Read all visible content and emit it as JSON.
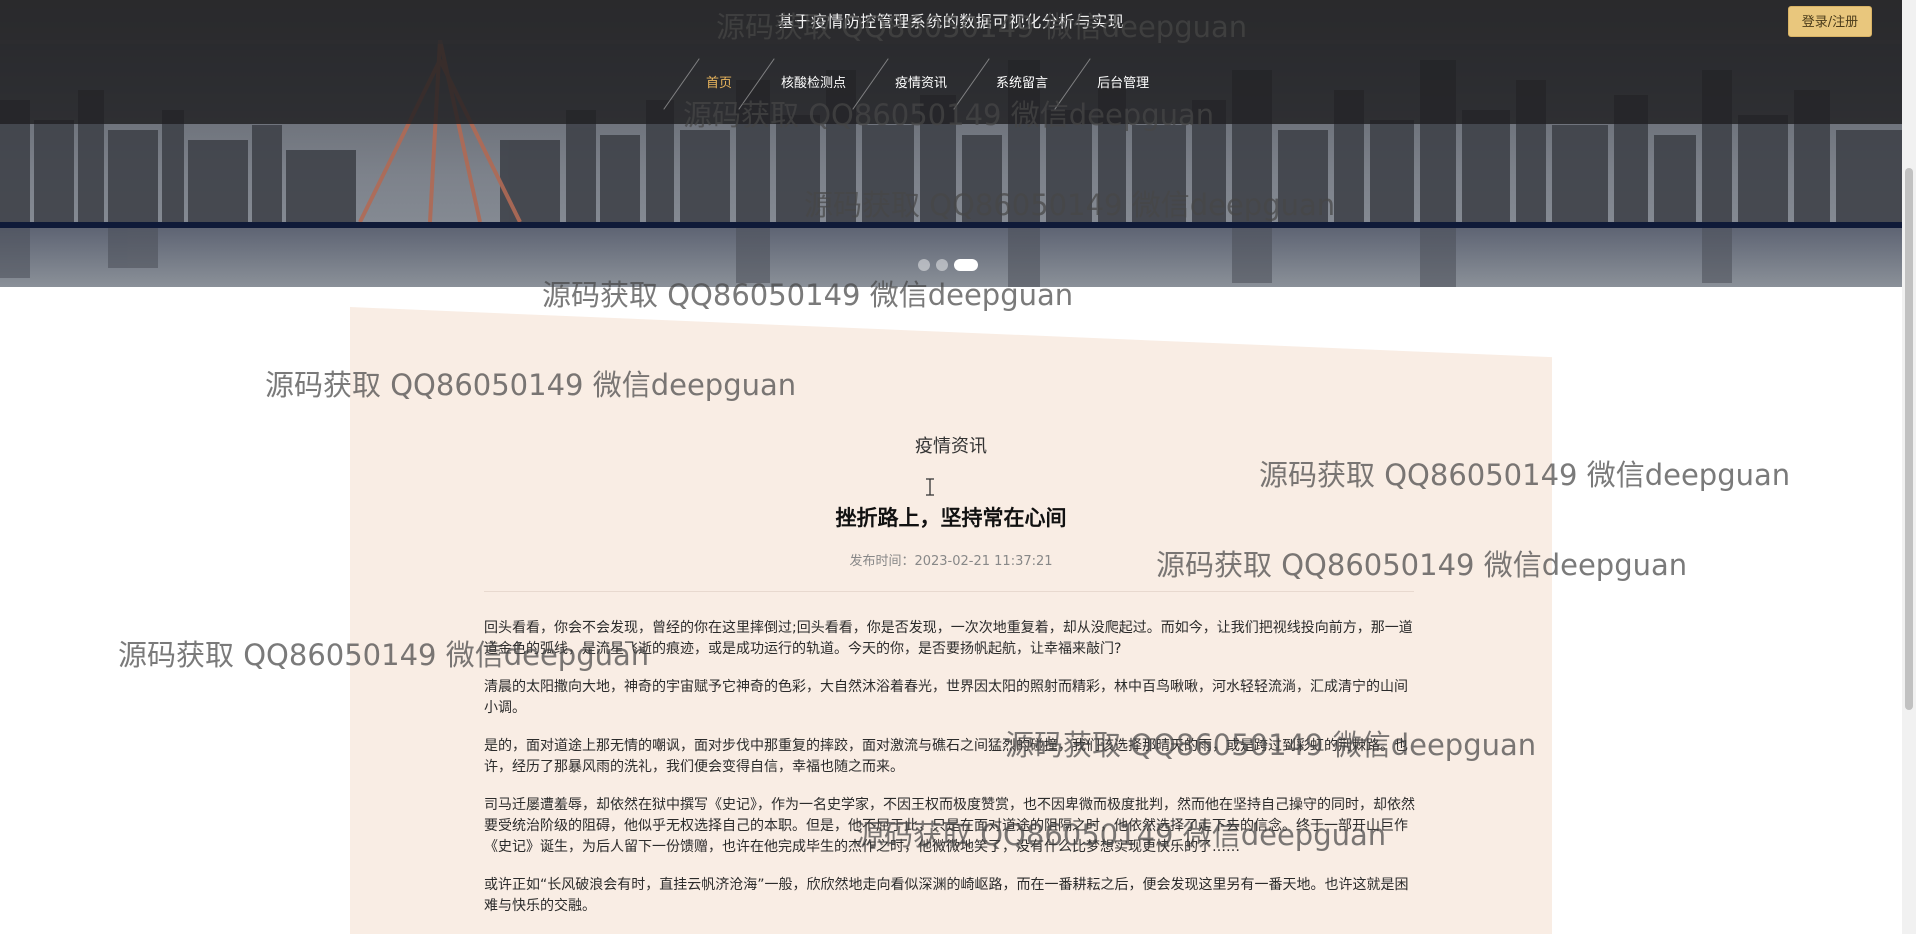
{
  "header": {
    "site_title": "基于疫情防控管理系统的数据可视化分析与实现",
    "login_label": "登录/注册"
  },
  "nav": {
    "items": [
      {
        "label": "首页",
        "active": true
      },
      {
        "label": "核酸检测点",
        "active": false
      },
      {
        "label": "疫情资讯",
        "active": false
      },
      {
        "label": "系统留言",
        "active": false
      },
      {
        "label": "后台管理",
        "active": false
      }
    ]
  },
  "carousel": {
    "slide_count": 3,
    "active_index": 2
  },
  "article": {
    "section_title": "疫情资讯",
    "title": "挫折路上，坚持常在心间",
    "publish_label": "发布时间：",
    "publish_time": "2023-02-21 11:37:21",
    "paragraphs": [
      "回头看看，你会不会发现，曾经的你在这里摔倒过;回头看看，你是否发现，一次次地重复着，却从没爬起过。而如今，让我们把视线投向前方，那一道道金色的弧线，是流星飞逝的痕迹，或是成功运行的轨道。今天的你，是否要扬帆起航，让幸福来敲门?",
      "清晨的太阳撒向大地，神奇的宇宙赋予它神奇的色彩，大自然沐浴着春光，世界因太阳的照射而精彩，林中百鸟啾啾，河水轻轻流淌，汇成清宁的山间小调。",
      "是的，面对道途上那无情的嘲讽，面对步伐中那重复的摔跤，面对激流与礁石之间猛烈的碰撞，我们该选择那晴天的雨，或是跨过到彩虹的荆棘路。也许，经历了那暴风雨的洗礼，我们便会变得自信，幸福也随之而来。",
      "司马迁屡遭羞辱，却依然在狱中撰写《史记》，作为一名史学家，不因王权而极度赞赏，也不因卑微而极度批判，然而他在坚持自己操守的同时，却依然要受统治阶级的阻碍，他似乎无权选择自己的本职。但是，他不屈于此，只是在面对道途的阻隔之时，他依然选择了走下去的信念。终于一部开山巨作《史记》诞生，为后人留下一份馈赠，也许在他完成毕生的杰作之时，他微微地笑了，没有什么比梦想实现更快乐的了……",
      "或许正如“长风破浪会有时，直挂云帆济沧海”一般，欣欣然地走向看似深渊的崎岖路，而在一番耕耘之后，便会发现这里另有一番天地。也许这就是困难与快乐的交融。"
    ]
  },
  "watermark": {
    "text": "源码获取 QQ86050149 微信deepguan"
  },
  "colors": {
    "accent": "#e9b55d",
    "login_bg": "#e9c77d",
    "content_bg": "#f9ede4"
  }
}
